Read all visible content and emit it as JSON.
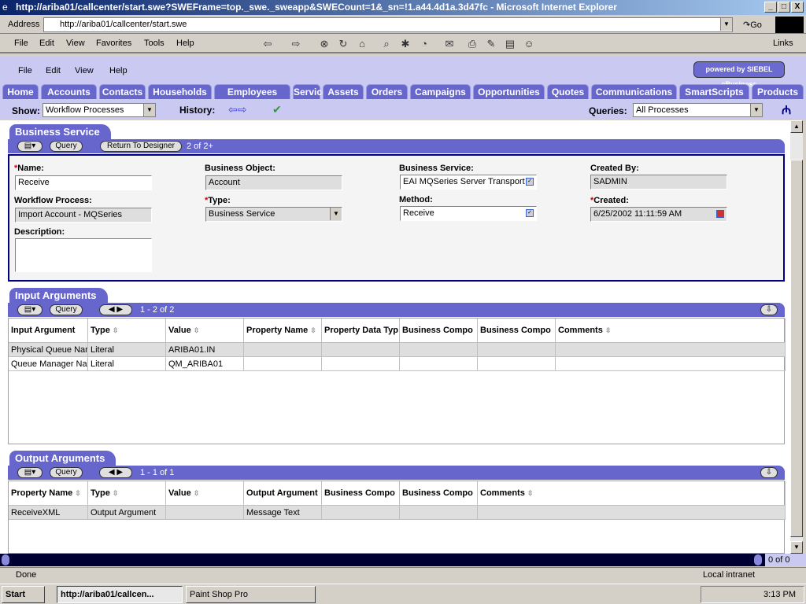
{
  "window": {
    "title": "http://ariba01/callcenter/start.swe?SWEFrame=top._swe._sweapp&SWECount=1&_sn=!1.a44.4d1a.3d47fc - Microsoft Internet Explorer"
  },
  "ie": {
    "address_label": "Address",
    "address": "http://ariba01/callcenter/start.swe",
    "go": "Go",
    "links": "Links",
    "menu": [
      "File",
      "Edit",
      "View",
      "Favorites",
      "Tools",
      "Help"
    ]
  },
  "app": {
    "menu": [
      "File",
      "Edit",
      "View",
      "Help"
    ],
    "logo": "powered by SIEBEL eBusiness",
    "tabs": [
      "Home",
      "Accounts",
      "Contacts",
      "Households",
      "Employees",
      "Service",
      "Assets",
      "Orders",
      "Campaigns",
      "Opportunities",
      "Quotes",
      "Communications",
      "SmartScripts",
      "Products"
    ],
    "show_label": "Show:",
    "show_value": "Workflow Processes",
    "history": "History:",
    "queries_label": "Queries:",
    "queries_value": "All Processes"
  },
  "business_service": {
    "title": "Business Service",
    "query": "Query",
    "return": "Return To Designer",
    "count": "2 of 2+",
    "fields": {
      "name_label": "Name:",
      "name": "Receive",
      "bo_label": "Business Object:",
      "bo": "Account",
      "bs_label": "Business Service:",
      "bs": "EAI MQSeries Server Transport",
      "cb_label": "Created By:",
      "cb": "SADMIN",
      "wp_label": "Workflow Process:",
      "wp": "Import Account - MQSeries",
      "type_label": "Type:",
      "type": "Business Service",
      "method_label": "Method:",
      "method": "Receive",
      "created_label": "Created:",
      "created": "6/25/2002 11:11:59 AM",
      "desc_label": "Description:"
    }
  },
  "input_args": {
    "title": "Input Arguments",
    "query": "Query",
    "count": "1 - 2 of 2",
    "columns": [
      "Input Argument",
      "Type",
      "Value",
      "Property Name",
      "Property Data Typ",
      "Business Compo",
      "Business Compo",
      "Comments"
    ],
    "rows": [
      [
        "Physical Queue Nar",
        "Literal",
        "ARIBA01.IN",
        "",
        "",
        "",
        "",
        ""
      ],
      [
        "Queue Manager Nar",
        "Literal",
        "QM_ARIBA01",
        "",
        "",
        "",
        "",
        ""
      ]
    ]
  },
  "output_args": {
    "title": "Output Arguments",
    "query": "Query",
    "count": "1 - 1 of 1",
    "columns": [
      "Property Name",
      "Type",
      "Value",
      "Output Argument",
      "Business Compo",
      "Business Compo",
      "Comments"
    ],
    "rows": [
      [
        "ReceiveXML",
        "Output Argument",
        "",
        "Message Text",
        "",
        "",
        ""
      ]
    ]
  },
  "bottom_count": "0 of 0",
  "status": {
    "text": "Done",
    "zone": "Local intranet"
  },
  "taskbar": {
    "start": "Start",
    "items": [
      "http://ariba01/callcen...",
      "Paint Shop Pro"
    ],
    "time": "3:13 PM"
  }
}
